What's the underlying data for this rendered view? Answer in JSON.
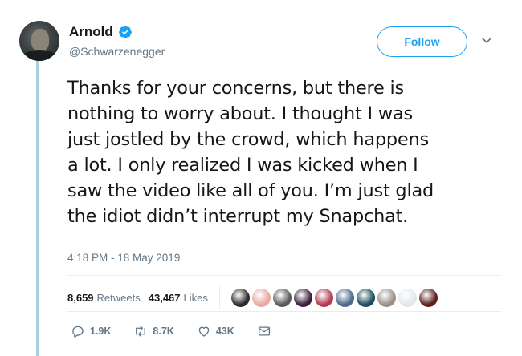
{
  "tweet": {
    "display_name": "Arnold",
    "handle": "@Schwarzenegger",
    "follow_label": "Follow",
    "text_lines": [
      "Thanks for your concerns, but there is",
      "nothing to worry about. I thought I was",
      "just jostled by the crowd, which happens",
      "a lot. I only realized I was kicked when I",
      "saw the video like all of you. I’m just glad",
      "the idiot didn’t interrupt my Snapchat."
    ],
    "timestamp": "4:18 PM - 18 May 2019",
    "stats": {
      "retweets_count": "8,659",
      "retweets_label": "Retweets",
      "likes_count": "43,467",
      "likes_label": "Likes"
    },
    "likers": [
      {
        "color": "#2b2b2b"
      },
      {
        "color": "#e9a7a0"
      },
      {
        "color": "#5a5a5a"
      },
      {
        "color": "#3a1f3f"
      },
      {
        "color": "#b33a52"
      },
      {
        "color": "#4a6a8a"
      },
      {
        "color": "#1b4d5c"
      },
      {
        "color": "#9a8f85"
      },
      {
        "color": "#e3e7ea"
      },
      {
        "color": "#5a1e1e"
      }
    ],
    "actions": {
      "replies": "1.9K",
      "retweets": "8.7K",
      "likes": "43K"
    }
  },
  "icons": [
    "verified-badge-icon",
    "chevron-down-icon",
    "reply-icon",
    "retweet-icon",
    "like-icon",
    "direct-message-icon"
  ],
  "colors": {
    "accent": "#1da1f2",
    "muted": "#657786",
    "thread": "#a8d0dd",
    "text": "#14171a"
  }
}
